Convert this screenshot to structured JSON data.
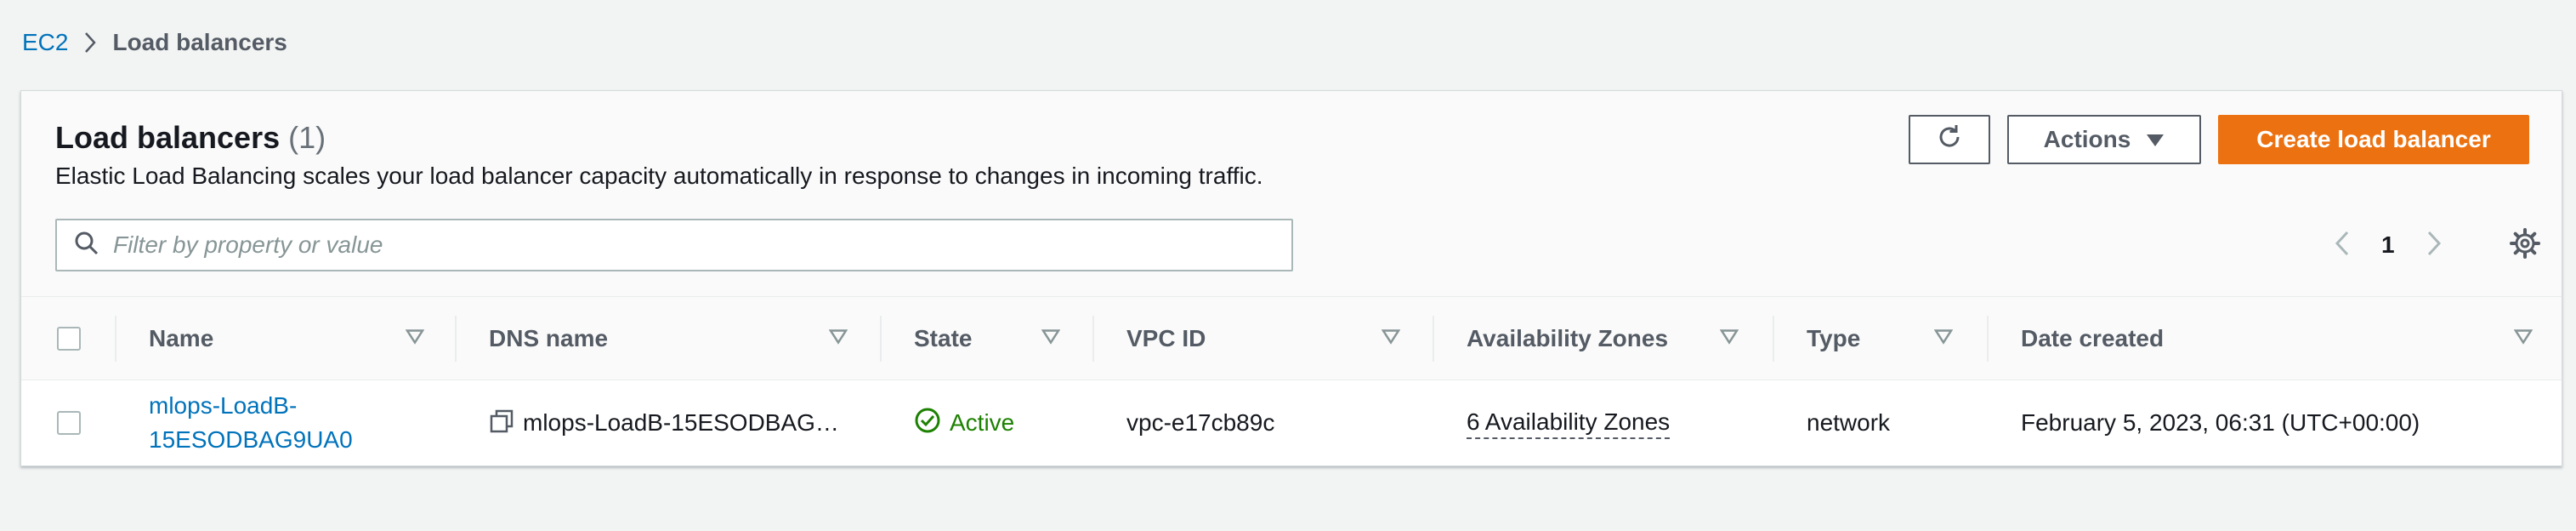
{
  "breadcrumb": {
    "parent": "EC2",
    "current": "Load balancers"
  },
  "panel": {
    "title": "Load balancers",
    "count": "(1)",
    "description": "Elastic Load Balancing scales your load balancer capacity automatically in response to changes in incoming traffic."
  },
  "toolbar": {
    "actions_label": "Actions",
    "create_label": "Create load balancer"
  },
  "filter": {
    "placeholder": "Filter by property or value",
    "value": ""
  },
  "pagination": {
    "current_page": "1"
  },
  "table": {
    "columns": [
      "Name",
      "DNS name",
      "State",
      "VPC ID",
      "Availability Zones",
      "Type",
      "Date created"
    ],
    "rows": [
      {
        "name_line1": "mlops-LoadB-",
        "name_line2": "15ESODBAG9UA0",
        "dns_name": "mlops-LoadB-15ESODBAG…",
        "state": "Active",
        "vpc_id": "vpc-e17cb89c",
        "availability_zones": "6 Availability Zones",
        "type": "network",
        "date_created": "February 5, 2023, 06:31 (UTC+00:00)"
      }
    ]
  },
  "colors": {
    "accent": "#ec7211",
    "link": "#0073bb",
    "success": "#1d8102"
  },
  "icons": {
    "breadcrumb_separator": "chevron-right-icon",
    "refresh": "refresh-icon",
    "actions_caret": "caret-down-icon",
    "filter": "search-icon",
    "prev_page": "chevron-left-icon",
    "next_page": "chevron-right-icon",
    "preferences": "gear-icon",
    "sort": "sort-triangle-icon",
    "copy": "copy-icon",
    "status": "check-circle-icon"
  }
}
